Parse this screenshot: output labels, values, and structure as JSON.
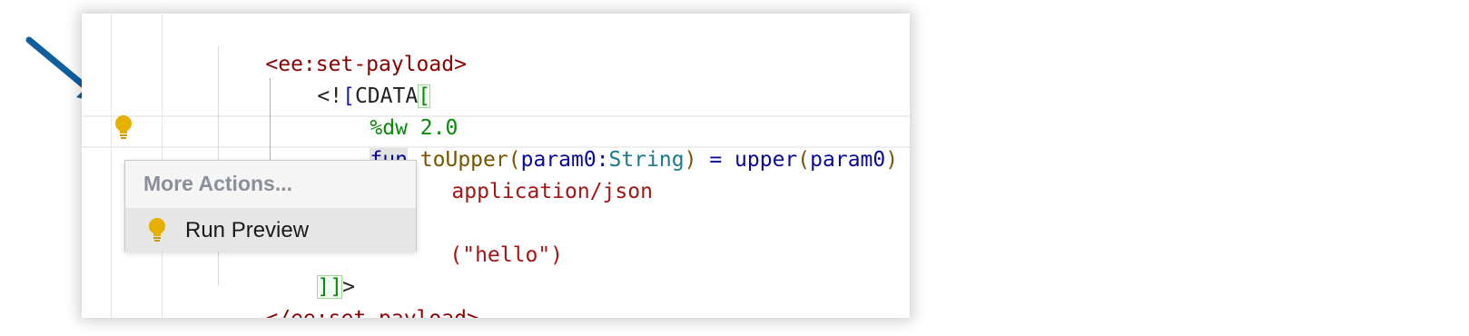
{
  "code_lines": [
    {
      "id": "open-tag",
      "text": "<ee:set-payload>"
    },
    {
      "id": "cdata-open",
      "prefix": "<!",
      "bracket1": "[",
      "keyword": "CDATA",
      "bracket2": "["
    },
    {
      "id": "dw-version",
      "text": "%dw 2.0"
    },
    {
      "id": "fun-decl",
      "kw": "fun",
      "name": "toUpper",
      "open": "(",
      "param": "param0",
      "colon": ":",
      "type": "String",
      "close": ")",
      "eq": " = ",
      "call": "upper",
      "open2": "(",
      "arg": "param0",
      "close2": ")"
    },
    {
      "id": "output-line",
      "visible": "application/json"
    },
    {
      "id": "call-line",
      "visible": "(\"hello\")"
    },
    {
      "id": "cdata-close",
      "brackets": "]]",
      "gt": ">"
    },
    {
      "id": "close-tag",
      "text": "</ee:set-payload>"
    }
  ],
  "popup": {
    "title": "More Actions...",
    "item_label": "Run Preview",
    "item_icon": "lightbulb-icon"
  },
  "colors": {
    "tag": "#8b0000",
    "keyword": "#0a0a9a",
    "bulb": "#e5b000",
    "arrow": "#0d5fa0"
  }
}
